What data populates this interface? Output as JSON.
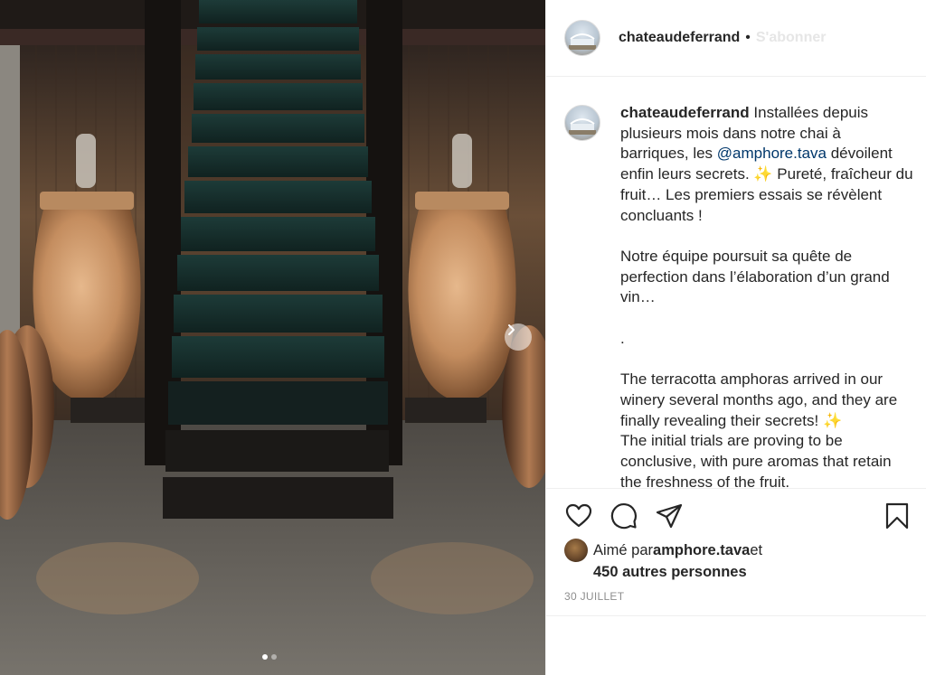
{
  "post": {
    "username": "chateaudeferrand",
    "separator": "•",
    "follow_label": "S'abonner"
  },
  "caption": {
    "username": "chateaudeferrand",
    "part1": " Installées depuis plusieurs mois dans notre chai à barriques, les ",
    "mention": "@amphore.tava",
    "part2": " dévoilent enfin leurs secrets. ",
    "sparkle": "✨",
    "part3": " Pureté, fraîcheur du fruit… Les premiers essais se révèlent concluants !\n\nNotre équipe poursuit sa quête de perfection dans l’élaboration d’un grand vin…\n\n.\n\nThe terracotta amphoras arrived in our winery several months ago, and they are finally revealing their secrets! ",
    "sparkle2": "✨",
    "part4": "\nThe initial trials are proving to be conclusive, with pure aromas that retain the freshness of the fruit."
  },
  "likes": {
    "prefix": "Aimé par ",
    "liker": "amphore.tava",
    "suffix": " et",
    "others": "450 autres personnes"
  },
  "date": "30 JUILLET",
  "icons": {
    "like": "heart-icon",
    "comment": "comment-bubble-icon",
    "share": "paper-plane-icon",
    "save": "bookmark-icon",
    "next": "chevron-right-icon"
  },
  "carousel": {
    "count": 2,
    "current": 1
  },
  "colors": {
    "link": "#00376b",
    "meta": "#8e8e8e",
    "text": "#262626",
    "border": "#efefef"
  }
}
